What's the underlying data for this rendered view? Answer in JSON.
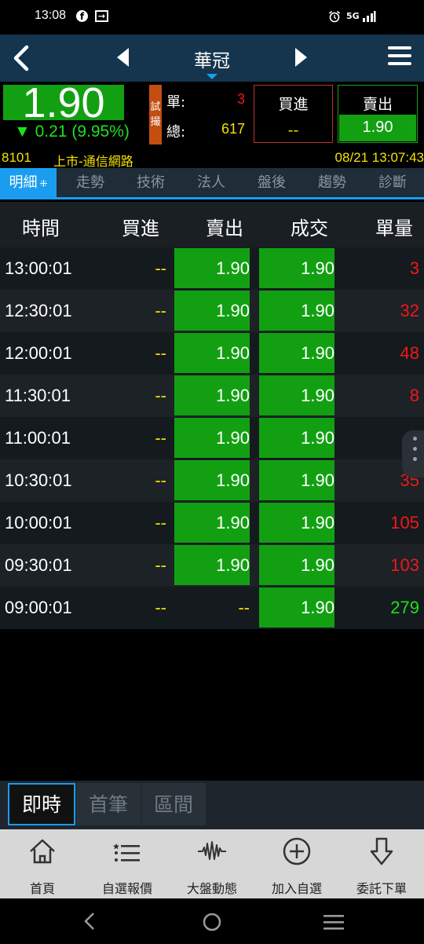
{
  "status": {
    "time": "13:08",
    "network": "5G"
  },
  "header": {
    "title": "華冠"
  },
  "quote": {
    "price": "1.90",
    "change": "▼ 0.21 (9.95%)",
    "trial_label": "試撮",
    "single_label": "單:",
    "single_value": "3",
    "total_label": "總:",
    "total_value": "617",
    "bid_label": "買進",
    "bid_value": "--",
    "ask_label": "賣出",
    "ask_value": "1.90"
  },
  "info": {
    "code": "8101",
    "market": "上市-通信網路",
    "datetime": "08/21 13:07:43"
  },
  "tabs": [
    {
      "label": "明細"
    },
    {
      "label": "走勢"
    },
    {
      "label": "技術"
    },
    {
      "label": "法人"
    },
    {
      "label": "盤後"
    },
    {
      "label": "趨勢"
    },
    {
      "label": "診斷"
    }
  ],
  "table": {
    "headers": [
      "時間",
      "買進",
      "賣出",
      "成交",
      "單量"
    ],
    "rows": [
      {
        "time": "13:00:01",
        "bid": "--",
        "ask": "1.90",
        "trade": "1.90",
        "vol": "3"
      },
      {
        "time": "12:30:01",
        "bid": "--",
        "ask": "1.90",
        "trade": "1.90",
        "vol": "32"
      },
      {
        "time": "12:00:01",
        "bid": "--",
        "ask": "1.90",
        "trade": "1.90",
        "vol": "48"
      },
      {
        "time": "11:30:01",
        "bid": "--",
        "ask": "1.90",
        "trade": "1.90",
        "vol": "8"
      },
      {
        "time": "11:00:01",
        "bid": "--",
        "ask": "1.90",
        "trade": "1.90",
        "vol": "4"
      },
      {
        "time": "10:30:01",
        "bid": "--",
        "ask": "1.90",
        "trade": "1.90",
        "vol": "35"
      },
      {
        "time": "10:00:01",
        "bid": "--",
        "ask": "1.90",
        "trade": "1.90",
        "vol": "105"
      },
      {
        "time": "09:30:01",
        "bid": "--",
        "ask": "1.90",
        "trade": "1.90",
        "vol": "103"
      },
      {
        "time": "09:00:01",
        "bid": "--",
        "ask": "--",
        "trade": "1.90",
        "vol": "279"
      }
    ]
  },
  "segments": [
    "即時",
    "首筆",
    "區間"
  ],
  "bottom_nav": [
    {
      "label": "首頁",
      "icon": "home-icon"
    },
    {
      "label": "自選報價",
      "icon": "list-icon"
    },
    {
      "label": "大盤動態",
      "icon": "waveform-icon"
    },
    {
      "label": "加入自選",
      "icon": "plus-circle-icon"
    },
    {
      "label": "委託下單",
      "icon": "arrow-down-icon"
    }
  ],
  "colors": {
    "accent": "#1a9df0",
    "up": "#12a012",
    "down": "#f01818",
    "header": "#15344d"
  }
}
